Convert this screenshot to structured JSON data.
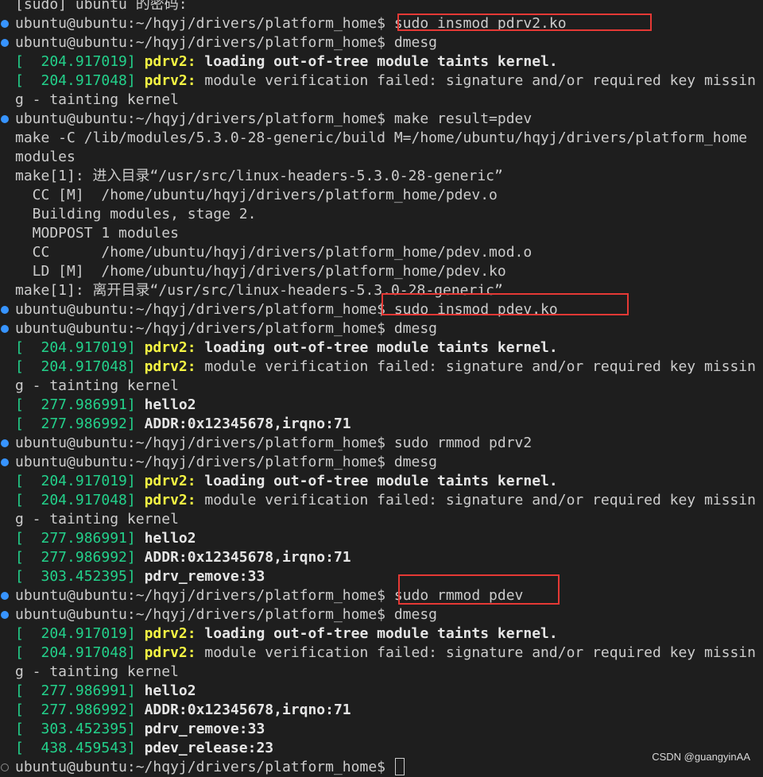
{
  "colors": {
    "background": "#1e1e1e",
    "default_text": "#cccccc",
    "green": "#23d18b",
    "yellow": "#f5f543",
    "marker_blue": "#3794ff",
    "highlight_box": "#e53935"
  },
  "terminal": {
    "lines": [
      {
        "marker": "none",
        "segments": [
          {
            "text": "[sudo] ubuntu 的密码:",
            "color": "default"
          }
        ]
      },
      {
        "marker": "filled",
        "segments": [
          {
            "text": "ubuntu@ubuntu:~/hqyj/drivers/platform_home$ sudo insmod pdrv2.ko",
            "color": "default"
          }
        ]
      },
      {
        "marker": "filled",
        "segments": [
          {
            "text": "ubuntu@ubuntu:~/hqyj/drivers/platform_home$ dmesg",
            "color": "default"
          }
        ]
      },
      {
        "marker": "none",
        "segments": [
          {
            "text": "[  204.917019] ",
            "color": "green"
          },
          {
            "text": "pdrv2: ",
            "color": "yellow",
            "bold": true
          },
          {
            "text": "loading out-of-tree module taints kernel.",
            "color": "bright",
            "bold": true
          }
        ]
      },
      {
        "marker": "none",
        "segments": [
          {
            "text": "[  204.917048] ",
            "color": "green"
          },
          {
            "text": "pdrv2: ",
            "color": "yellow",
            "bold": true
          },
          {
            "text": "module verification failed: signature and/or required key missin",
            "color": "default"
          }
        ]
      },
      {
        "marker": "none",
        "segments": [
          {
            "text": "g - tainting kernel",
            "color": "default"
          }
        ]
      },
      {
        "marker": "filled",
        "segments": [
          {
            "text": "ubuntu@ubuntu:~/hqyj/drivers/platform_home$ make result=pdev",
            "color": "default"
          }
        ]
      },
      {
        "marker": "none",
        "segments": [
          {
            "text": "make -C /lib/modules/5.3.0-28-generic/build M=/home/ubuntu/hqyj/drivers/platform_home",
            "color": "default"
          }
        ]
      },
      {
        "marker": "none",
        "segments": [
          {
            "text": "modules",
            "color": "default"
          }
        ]
      },
      {
        "marker": "none",
        "segments": [
          {
            "text": "make[1]: 进入目录“/usr/src/linux-headers-5.3.0-28-generic”",
            "color": "default"
          }
        ]
      },
      {
        "marker": "none",
        "segments": [
          {
            "text": "  CC [M]  /home/ubuntu/hqyj/drivers/platform_home/pdev.o",
            "color": "default"
          }
        ]
      },
      {
        "marker": "none",
        "segments": [
          {
            "text": "  Building modules, stage 2.",
            "color": "default"
          }
        ]
      },
      {
        "marker": "none",
        "segments": [
          {
            "text": "  MODPOST 1 modules",
            "color": "default"
          }
        ]
      },
      {
        "marker": "none",
        "segments": [
          {
            "text": "  CC      /home/ubuntu/hqyj/drivers/platform_home/pdev.mod.o",
            "color": "default"
          }
        ]
      },
      {
        "marker": "none",
        "segments": [
          {
            "text": "  LD [M]  /home/ubuntu/hqyj/drivers/platform_home/pdev.ko",
            "color": "default"
          }
        ]
      },
      {
        "marker": "none",
        "segments": [
          {
            "text": "make[1]: 离开目录“/usr/src/linux-headers-5.3.0-28-generic”",
            "color": "default"
          }
        ]
      },
      {
        "marker": "filled",
        "segments": [
          {
            "text": "ubuntu@ubuntu:~/hqyj/drivers/platform_home$ sudo insmod pdev.ko",
            "color": "default"
          }
        ]
      },
      {
        "marker": "filled",
        "segments": [
          {
            "text": "ubuntu@ubuntu:~/hqyj/drivers/platform_home$ dmesg",
            "color": "default"
          }
        ]
      },
      {
        "marker": "none",
        "segments": [
          {
            "text": "[  204.917019] ",
            "color": "green"
          },
          {
            "text": "pdrv2: ",
            "color": "yellow",
            "bold": true
          },
          {
            "text": "loading out-of-tree module taints kernel.",
            "color": "bright",
            "bold": true
          }
        ]
      },
      {
        "marker": "none",
        "segments": [
          {
            "text": "[  204.917048] ",
            "color": "green"
          },
          {
            "text": "pdrv2: ",
            "color": "yellow",
            "bold": true
          },
          {
            "text": "module verification failed: signature and/or required key missin",
            "color": "default"
          }
        ]
      },
      {
        "marker": "none",
        "segments": [
          {
            "text": "g - tainting kernel",
            "color": "default"
          }
        ]
      },
      {
        "marker": "none",
        "segments": [
          {
            "text": "[  277.986991] ",
            "color": "green"
          },
          {
            "text": "hello2",
            "color": "bright",
            "bold": true
          }
        ]
      },
      {
        "marker": "none",
        "segments": [
          {
            "text": "[  277.986992] ",
            "color": "green"
          },
          {
            "text": "ADDR:0x12345678,irqno:71",
            "color": "bright",
            "bold": true
          }
        ]
      },
      {
        "marker": "filled",
        "segments": [
          {
            "text": "ubuntu@ubuntu:~/hqyj/drivers/platform_home$ sudo rmmod pdrv2",
            "color": "default"
          }
        ]
      },
      {
        "marker": "filled",
        "segments": [
          {
            "text": "ubuntu@ubuntu:~/hqyj/drivers/platform_home$ dmesg",
            "color": "default"
          }
        ]
      },
      {
        "marker": "none",
        "segments": [
          {
            "text": "[  204.917019] ",
            "color": "green"
          },
          {
            "text": "pdrv2: ",
            "color": "yellow",
            "bold": true
          },
          {
            "text": "loading out-of-tree module taints kernel.",
            "color": "bright",
            "bold": true
          }
        ]
      },
      {
        "marker": "none",
        "segments": [
          {
            "text": "[  204.917048] ",
            "color": "green"
          },
          {
            "text": "pdrv2: ",
            "color": "yellow",
            "bold": true
          },
          {
            "text": "module verification failed: signature and/or required key missin",
            "color": "default"
          }
        ]
      },
      {
        "marker": "none",
        "segments": [
          {
            "text": "g - tainting kernel",
            "color": "default"
          }
        ]
      },
      {
        "marker": "none",
        "segments": [
          {
            "text": "[  277.986991] ",
            "color": "green"
          },
          {
            "text": "hello2",
            "color": "bright",
            "bold": true
          }
        ]
      },
      {
        "marker": "none",
        "segments": [
          {
            "text": "[  277.986992] ",
            "color": "green"
          },
          {
            "text": "ADDR:0x12345678,irqno:71",
            "color": "bright",
            "bold": true
          }
        ]
      },
      {
        "marker": "none",
        "segments": [
          {
            "text": "[  303.452395] ",
            "color": "green"
          },
          {
            "text": "pdrv_remove:33",
            "color": "bright",
            "bold": true
          }
        ]
      },
      {
        "marker": "filled",
        "segments": [
          {
            "text": "ubuntu@ubuntu:~/hqyj/drivers/platform_home$ sudo rmmod pdev",
            "color": "default"
          }
        ]
      },
      {
        "marker": "filled",
        "segments": [
          {
            "text": "ubuntu@ubuntu:~/hqyj/drivers/platform_home$ dmesg",
            "color": "default"
          }
        ]
      },
      {
        "marker": "none",
        "segments": [
          {
            "text": "[  204.917019] ",
            "color": "green"
          },
          {
            "text": "pdrv2: ",
            "color": "yellow",
            "bold": true
          },
          {
            "text": "loading out-of-tree module taints kernel.",
            "color": "bright",
            "bold": true
          }
        ]
      },
      {
        "marker": "none",
        "segments": [
          {
            "text": "[  204.917048] ",
            "color": "green"
          },
          {
            "text": "pdrv2: ",
            "color": "yellow",
            "bold": true
          },
          {
            "text": "module verification failed: signature and/or required key missin",
            "color": "default"
          }
        ]
      },
      {
        "marker": "none",
        "segments": [
          {
            "text": "g - tainting kernel",
            "color": "default"
          }
        ]
      },
      {
        "marker": "none",
        "segments": [
          {
            "text": "[  277.986991] ",
            "color": "green"
          },
          {
            "text": "hello2",
            "color": "bright",
            "bold": true
          }
        ]
      },
      {
        "marker": "none",
        "segments": [
          {
            "text": "[  277.986992] ",
            "color": "green"
          },
          {
            "text": "ADDR:0x12345678,irqno:71",
            "color": "bright",
            "bold": true
          }
        ]
      },
      {
        "marker": "none",
        "segments": [
          {
            "text": "[  303.452395] ",
            "color": "green"
          },
          {
            "text": "pdrv_remove:33",
            "color": "bright",
            "bold": true
          }
        ]
      },
      {
        "marker": "none",
        "segments": [
          {
            "text": "[  438.459543] ",
            "color": "green"
          },
          {
            "text": "pdev_release:23",
            "color": "bright",
            "bold": true
          }
        ]
      },
      {
        "marker": "hollow",
        "segments": [
          {
            "text": "ubuntu@ubuntu:~/hqyj/drivers/platform_home$ ",
            "color": "default"
          }
        ],
        "cursor": true
      }
    ]
  },
  "watermark": {
    "text": "CSDN @guangyinAA"
  }
}
